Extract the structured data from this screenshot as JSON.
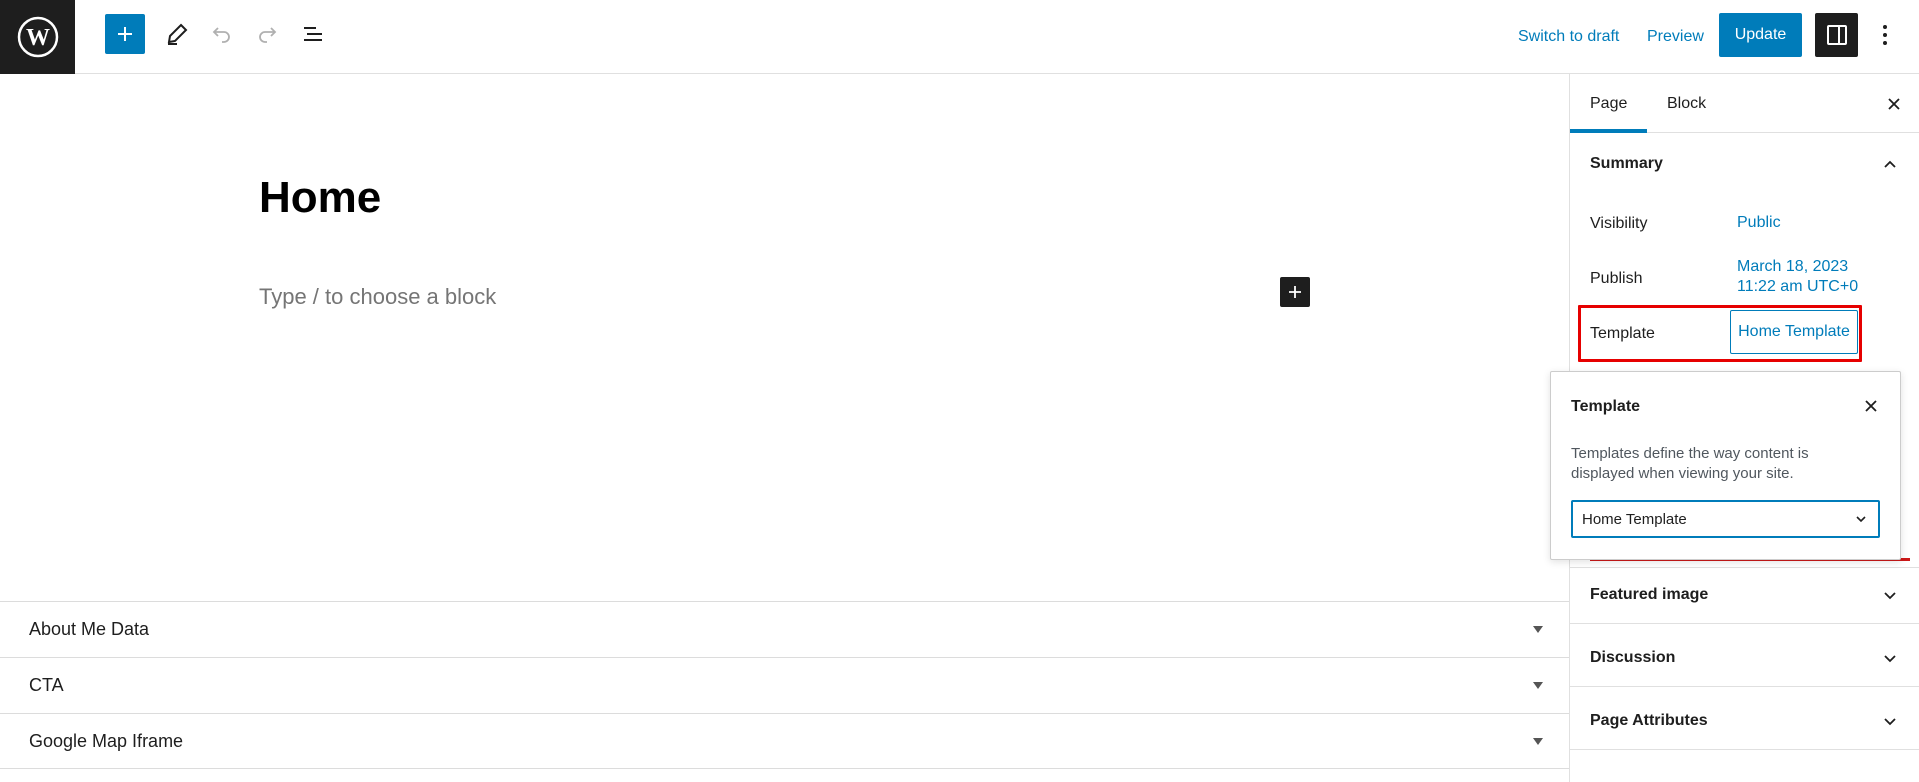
{
  "toolbar": {
    "switch_to_draft": "Switch to draft",
    "preview": "Preview",
    "update": "Update"
  },
  "editor": {
    "title": "Home",
    "placeholder": "Type / to choose a block"
  },
  "metaboxes": [
    {
      "label": "About Me Data"
    },
    {
      "label": "CTA"
    },
    {
      "label": "Google Map Iframe"
    }
  ],
  "sidebar": {
    "tabs": [
      "Page",
      "Block"
    ],
    "summary": {
      "title": "Summary",
      "visibility_label": "Visibility",
      "visibility_value": "Public",
      "publish_label": "Publish",
      "publish_date": "March 18, 2023",
      "publish_time": "11:22 am UTC+0",
      "template_label": "Template",
      "template_value": "Home Template"
    },
    "panels": [
      "Featured image",
      "Discussion",
      "Page Attributes"
    ]
  },
  "popover": {
    "title": "Template",
    "description": "Templates define the way content is displayed when viewing your site.",
    "selected": "Home Template"
  },
  "colors": {
    "accent": "#007cba",
    "dark": "#1e1e1e",
    "highlight": "#e60000"
  }
}
